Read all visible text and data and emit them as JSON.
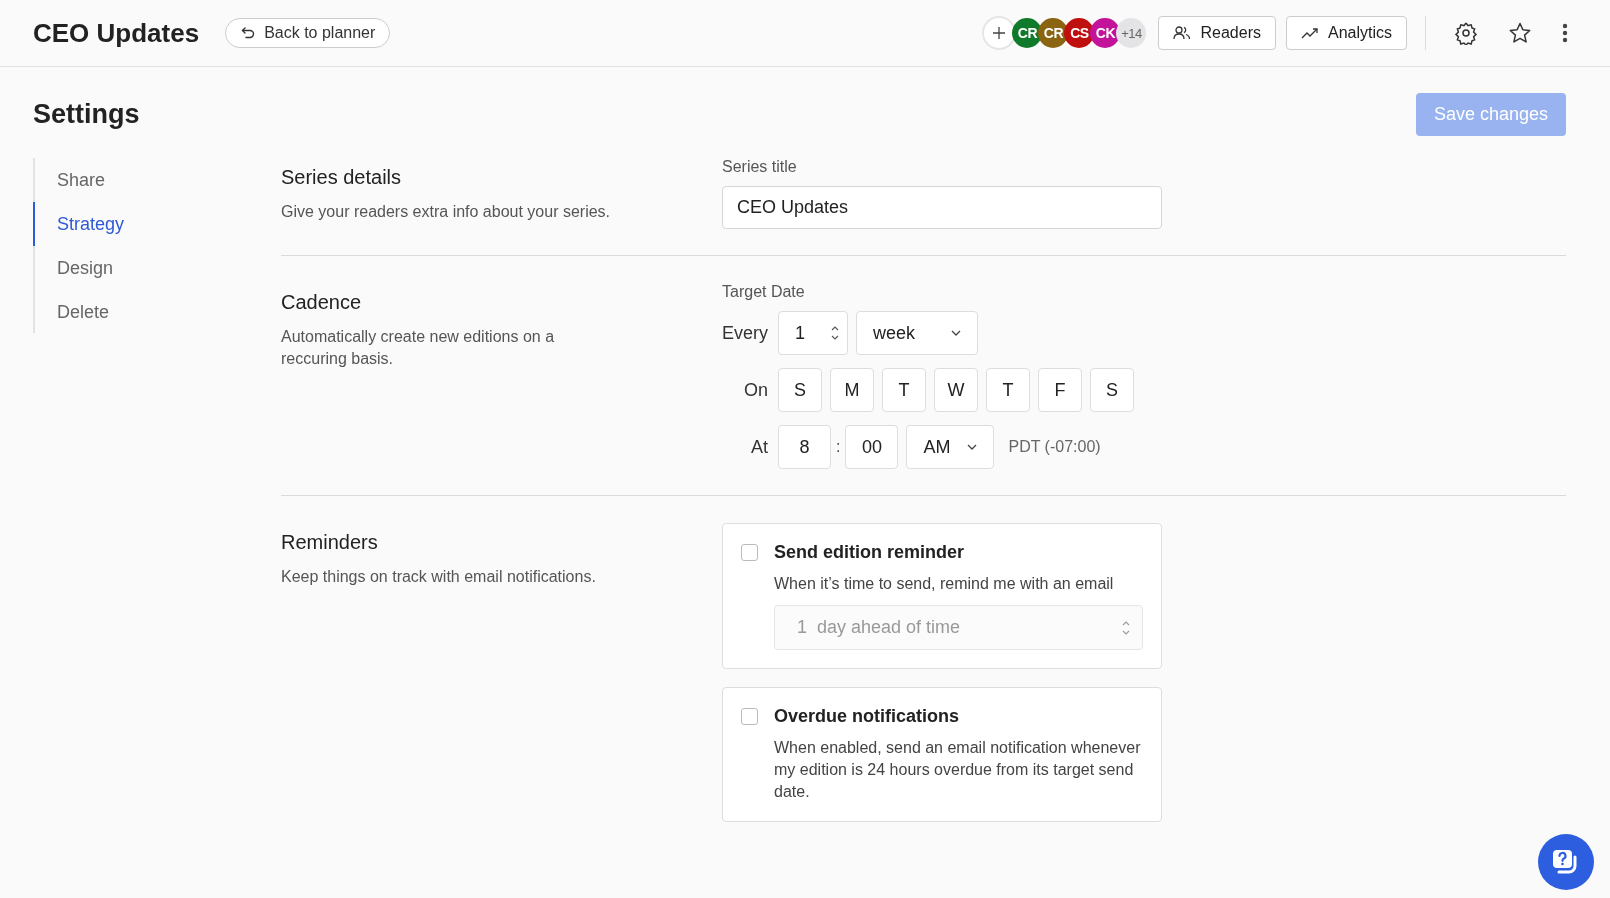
{
  "header": {
    "title": "CEO Updates",
    "back_button": "Back to planner",
    "avatars": [
      {
        "initials": "CR",
        "color": "#0f7a2a"
      },
      {
        "initials": "CR",
        "color": "#8a6410"
      },
      {
        "initials": "CS",
        "color": "#c00f0f"
      },
      {
        "initials": "CK",
        "color": "#c2139a"
      }
    ],
    "more_count": "+14",
    "buttons": [
      {
        "kind": "readers",
        "label": "Readers"
      },
      {
        "kind": "analytics",
        "label": "Analytics"
      }
    ]
  },
  "page": {
    "title": "Settings",
    "save_button": {
      "label": "Save changes",
      "disabled": true
    }
  },
  "sidebar": {
    "items": [
      {
        "label": "Share",
        "selected": false
      },
      {
        "label": "Strategy",
        "selected": true
      },
      {
        "label": "Design",
        "selected": false
      },
      {
        "label": "Delete",
        "selected": false
      }
    ]
  },
  "series_details": {
    "title": "Series details",
    "description": "Give your readers extra info about your series.",
    "field_label": "Series title",
    "field_value": "CEO Updates"
  },
  "cadence": {
    "title": "Cadence",
    "description": "Automatically create new editions on a reccuring basis.",
    "target_label": "Target Date",
    "every_label": "Every",
    "every_value": "1",
    "unit": "week",
    "on_label": "On",
    "days": [
      "S",
      "M",
      "T",
      "W",
      "T",
      "F",
      "S"
    ],
    "at_label": "At",
    "hour": "8",
    "separator": ":",
    "minute": "00",
    "period": "AM",
    "timezone": "PDT (-07:00)"
  },
  "reminders": {
    "title": "Reminders",
    "description": "Keep things on track with email notifications.",
    "options": [
      {
        "label": "Send edition reminder",
        "checked": false,
        "description": "When it’s time to send, remind me with an email",
        "select": {
          "value": "1  day ahead of time",
          "disabled": true
        }
      },
      {
        "label": "Overdue notifications",
        "checked": false,
        "description": "When enabled, send an email notification whenever my edition is 24 hours overdue from its target send date."
      }
    ]
  }
}
